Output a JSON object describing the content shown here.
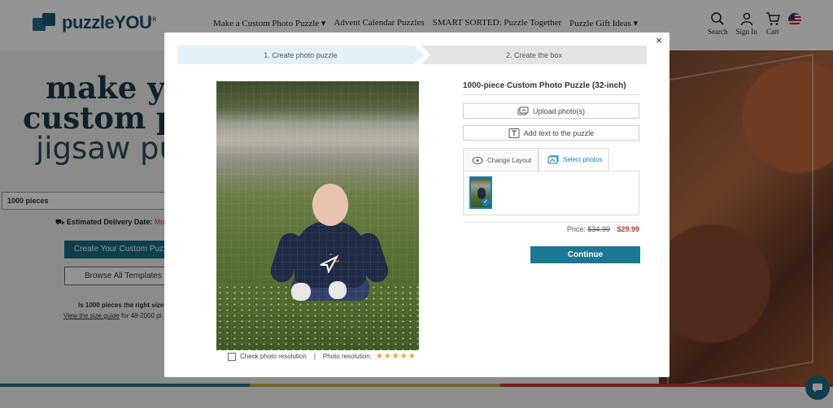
{
  "header": {
    "logo_text": "puzzleYOU",
    "logo_trademark": "®",
    "nav": [
      {
        "label": "Make a Custom Photo Puzzle",
        "has_dropdown": true
      },
      {
        "label": "Advent Calendar Puzzles",
        "has_dropdown": false
      },
      {
        "label": "SMART SORTED: Puzzle Together",
        "has_dropdown": false
      },
      {
        "label": "Puzzle Gift Ideas",
        "has_dropdown": true
      }
    ],
    "icons": {
      "search": "Search",
      "signin": "Sign In",
      "cart": "Cart"
    }
  },
  "hero": {
    "title_line1": "make yo",
    "title_line2": "custom ph",
    "title_line3": "jigsaw puz",
    "pieces_select": "1000 pieces",
    "delivery_label": "Estimated Delivery Date:",
    "delivery_value": "Mon, 1",
    "primary_button": "Create Your Custom Puzzle",
    "secondary_button": "Browse All Templates",
    "size_question": "Is 1000 pieces the right size?",
    "size_guide_link": "View the size guide",
    "size_guide_rest": " for 48-2000 pi"
  },
  "modal": {
    "close_symbol": "×",
    "steps": [
      "1. Create photo puzzle",
      "2. Create the box"
    ],
    "active_step": 0,
    "product_title": "1000-piece Custom Photo Puzzle (32-inch)",
    "upload_label": "Upload photo(s)",
    "add_text_label": "Add text to the puzzle",
    "tabs": [
      {
        "label": "Change Layout",
        "icon": "layout-icon",
        "active": false
      },
      {
        "label": "Select photos",
        "icon": "photos-icon",
        "active": true
      }
    ],
    "check_resolution_label": "Check photo resolution",
    "separator": "|",
    "resolution_label": "Photo resolution:",
    "resolution_stars": "★★★★★",
    "resolution_rating": 5,
    "price_label": "Price:",
    "price_old": "$34.99",
    "price_new": "$29.99",
    "continue_label": "Continue"
  },
  "colors": {
    "accent": "#1a7896",
    "price_sale": "#c0392b",
    "tab_active": "#1a7fb3",
    "step_active_bg": "#e3f1fa"
  }
}
